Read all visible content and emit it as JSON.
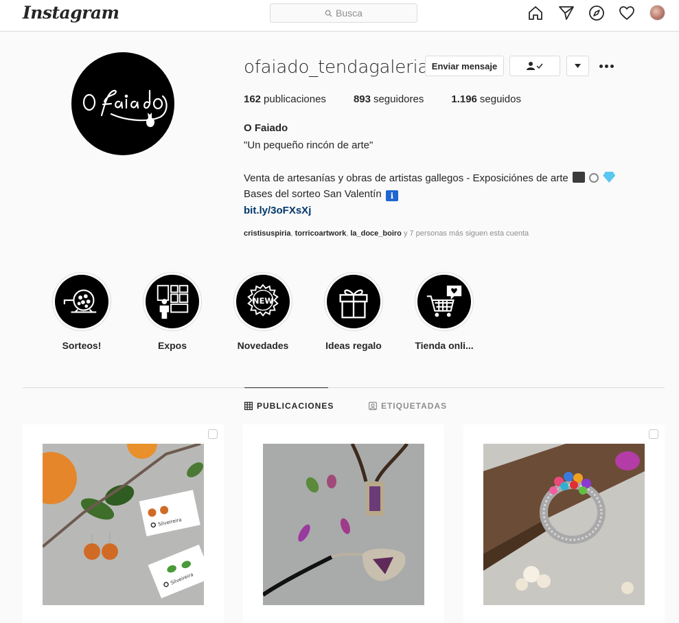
{
  "nav": {
    "logo": "Instagram",
    "search_placeholder": "Busca",
    "icons": [
      "home-icon",
      "direct-icon",
      "explore-icon",
      "activity-heart-icon",
      "profile-avatar"
    ]
  },
  "profile": {
    "username": "ofaiado_tendagaleria",
    "logo_text": "O Faiado",
    "buttons": {
      "message": "Enviar mensaje"
    },
    "stats": [
      {
        "value": "162",
        "label": "publicaciones"
      },
      {
        "value": "893",
        "label": "seguidores"
      },
      {
        "value": "1.196",
        "label": "seguidos"
      }
    ],
    "full_name": "O Faiado",
    "bio_quote": "\"Un pequeño rincón de arte\"",
    "bio_line1": "Venta de artesanías y obras de artistas gallegos - Exposiciónes de arte",
    "bio_line2": "Bases del sorteo San Valentín",
    "link": "bit.ly/3oFXsXj",
    "followed_by": {
      "users": [
        "cristisuspiria",
        "torricoartwork",
        "la_doce_boiro"
      ],
      "rest": "y 7 personas más siguen esta cuenta"
    }
  },
  "highlights": [
    {
      "label": "Sorteos!",
      "icon": "raffle-drum-icon"
    },
    {
      "label": "Expos",
      "icon": "gallery-visitor-icon"
    },
    {
      "label": "Novedades",
      "icon": "new-badge-icon"
    },
    {
      "label": "Ideas regalo",
      "icon": "gift-icon"
    },
    {
      "label": "Tienda onli...",
      "icon": "shopping-cart-icon"
    }
  ],
  "tabs": [
    {
      "label": "PUBLICACIONES",
      "icon": "grid-icon",
      "active": true
    },
    {
      "label": "ETIQUETADAS",
      "icon": "tagged-icon",
      "active": false
    }
  ],
  "posts": [
    {
      "id": "post-earrings",
      "brand_on_card": "Silveireira"
    },
    {
      "id": "post-pendants"
    },
    {
      "id": "post-ring"
    }
  ],
  "colors": {
    "link": "#00376b",
    "border": "#dbdbdb",
    "muted": "#8e8e8e",
    "text": "#262626"
  }
}
